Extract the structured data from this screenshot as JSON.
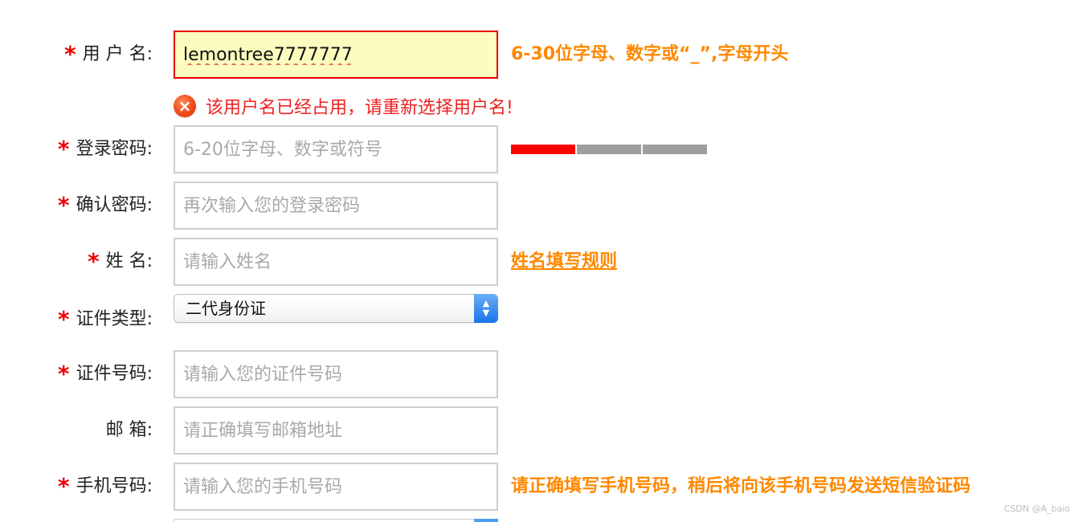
{
  "form": {
    "username": {
      "label": "用 户 名:",
      "value": "lemontree7777777",
      "hint": "6-30位字母、数字或“_”,字母开头",
      "error": "该用户名已经占用，请重新选择用户名!"
    },
    "password": {
      "label": "登录密码:",
      "placeholder": "6-20位字母、数字或符号",
      "strength_level": 1,
      "strength_max": 3
    },
    "confirm_password": {
      "label": "确认密码:",
      "placeholder": "再次输入您的登录密码"
    },
    "name": {
      "label": "姓 名:",
      "placeholder": "请输入姓名",
      "hint_link": "姓名填写规则"
    },
    "id_type": {
      "label": "证件类型:",
      "selected": "二代身份证"
    },
    "id_number": {
      "label": "证件号码:",
      "placeholder": "请输入您的证件号码"
    },
    "email": {
      "label": "邮 箱:",
      "placeholder": "请正确填写邮箱地址"
    },
    "phone": {
      "label": "手机号码:",
      "placeholder": "请输入您的手机号码",
      "hint": "请正确填写手机号码，稍后将向该手机号码发送短信验证码"
    },
    "required_mark": "*"
  },
  "watermark": "CSDN @A_baio",
  "colors": {
    "required": "#ee0000",
    "hint": "#ff8800",
    "error_text": "#ee2222",
    "error_border": "#e60000",
    "error_bg": "#fbfcbd",
    "strength_on": "#ff0000",
    "strength_off": "#9e9e9e"
  }
}
